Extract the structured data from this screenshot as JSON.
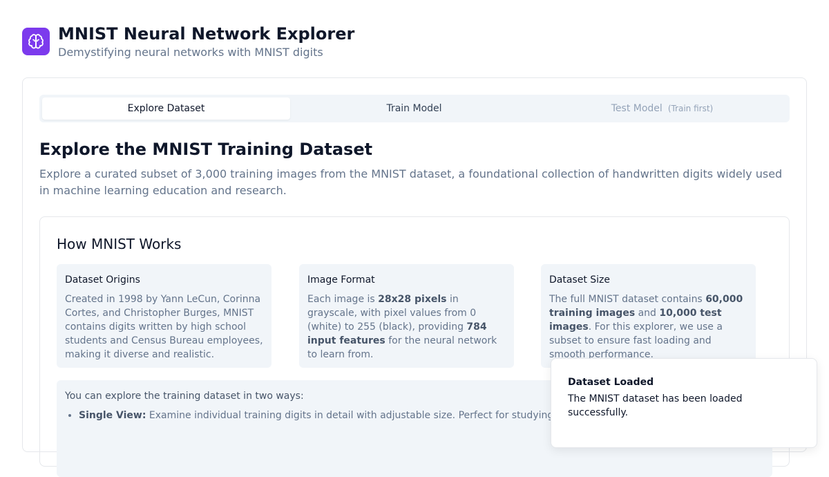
{
  "header": {
    "icon": "brain-icon",
    "title": "MNIST Neural Network Explorer",
    "subtitle": "Demystifying neural networks with MNIST digits"
  },
  "colors": {
    "accent": "#7c3aed",
    "muted": "#64748b",
    "surface": "#f1f5f9"
  },
  "tabs": [
    {
      "label": "Explore Dataset",
      "active": true
    },
    {
      "label": "Train Model",
      "active": false
    },
    {
      "label": "Test Model",
      "hint": "(Train first)",
      "disabled": true
    }
  ],
  "section": {
    "title": "Explore the MNIST Training Dataset",
    "description": "Explore a curated subset of 3,000 training images from the MNIST dataset, a foundational collection of handwritten digits widely used in machine learning education and research."
  },
  "how_it_works": {
    "title": "How MNIST Works",
    "cards": [
      {
        "title": "Dataset Origins",
        "text": [
          "Created in 1998 by Yann LeCun, Corinna Cortes, and Christopher Burges, MNIST contains digits written by high school students and Census Bureau employees, making it diverse and realistic."
        ]
      },
      {
        "title": "Image Format",
        "text": [
          "Each image is ",
          "28x28 pixels",
          " in grayscale, with pixel values from 0 (white) to 255 (black), providing ",
          "784 input features",
          " for the neural network to learn from."
        ]
      },
      {
        "title": "Dataset Size",
        "text": [
          "The full MNIST dataset contains ",
          "60,000 training images",
          " and ",
          "10,000 test images",
          ". For this explorer, we use a subset to ensure fast loading and smooth performance."
        ]
      }
    ]
  },
  "explore": {
    "intro": "You can explore the training dataset in two ways:",
    "items": [
      {
        "label": "Single View:",
        "text": " Examine individual training digits in detail with adjustable size. Perfect for studying handwriting styles."
      }
    ]
  },
  "toast": {
    "title": "Dataset Loaded",
    "message": "The MNIST dataset has been loaded successfully."
  }
}
